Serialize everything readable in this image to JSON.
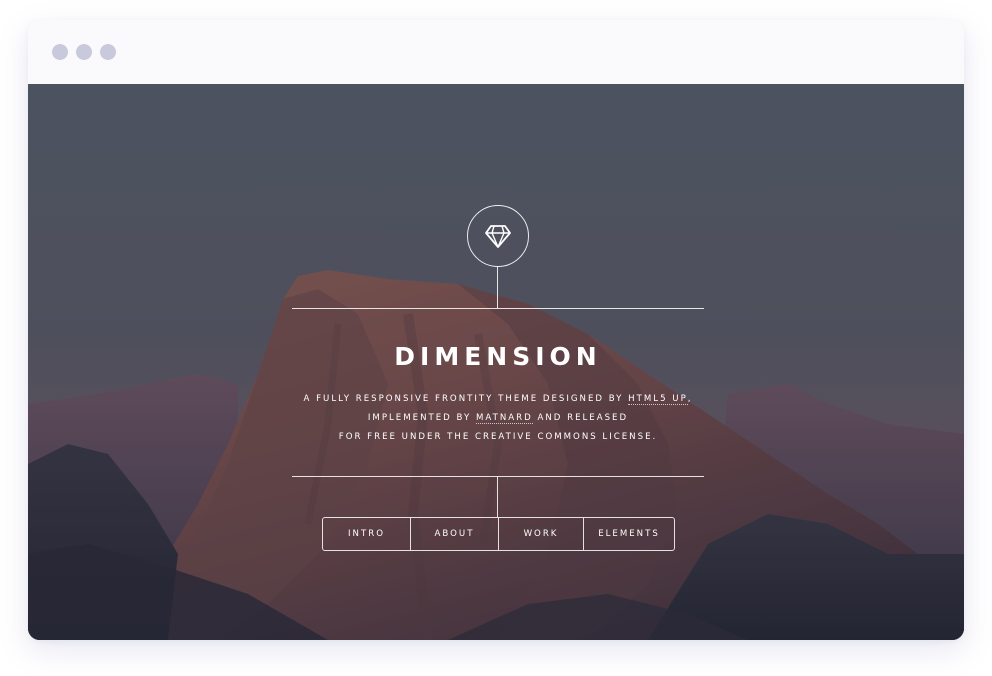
{
  "window": {
    "controls": [
      "window-dot",
      "window-dot",
      "window-dot"
    ]
  },
  "hero": {
    "logo_icon": "diamond-icon",
    "title": "DIMENSION",
    "tagline": {
      "line1_pre": "A fully responsive Frontity theme designed by ",
      "line1_link": "HTML5 UP",
      "line1_post": ",",
      "line2_pre": "implemented by ",
      "line2_link": "Matnard",
      "line2_post": " and released",
      "line3": "for free under the Creative Commons license."
    }
  },
  "nav": {
    "items": [
      "INTRO",
      "ABOUT",
      "WORK",
      "ELEMENTS"
    ]
  },
  "colors": {
    "window_dot": "#c8cadb",
    "titlebar": "#fafafc",
    "text": "#ffffff"
  }
}
